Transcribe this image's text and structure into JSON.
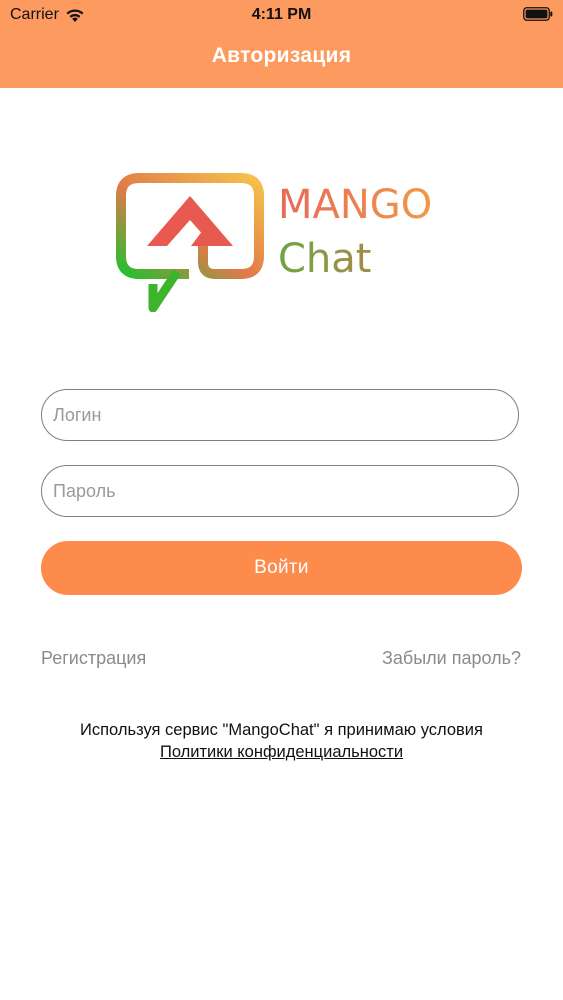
{
  "status_bar": {
    "carrier": "Carrier",
    "time": "4:11 PM"
  },
  "header": {
    "title": "Авторизация",
    "color": "#fd9a5f"
  },
  "logo": {
    "word1": "MANGO",
    "word2": "Chat"
  },
  "form": {
    "login_placeholder": "Логин",
    "password_placeholder": "Пароль",
    "submit_label": "Войти",
    "button_color": "#fd8b4c"
  },
  "links": {
    "register": "Регистрация",
    "forgot": "Забыли пароль?"
  },
  "terms": {
    "text": "Используя сервис \"MangoChat\" я принимаю условия",
    "policy_link": "Политики конфиденциальности"
  }
}
